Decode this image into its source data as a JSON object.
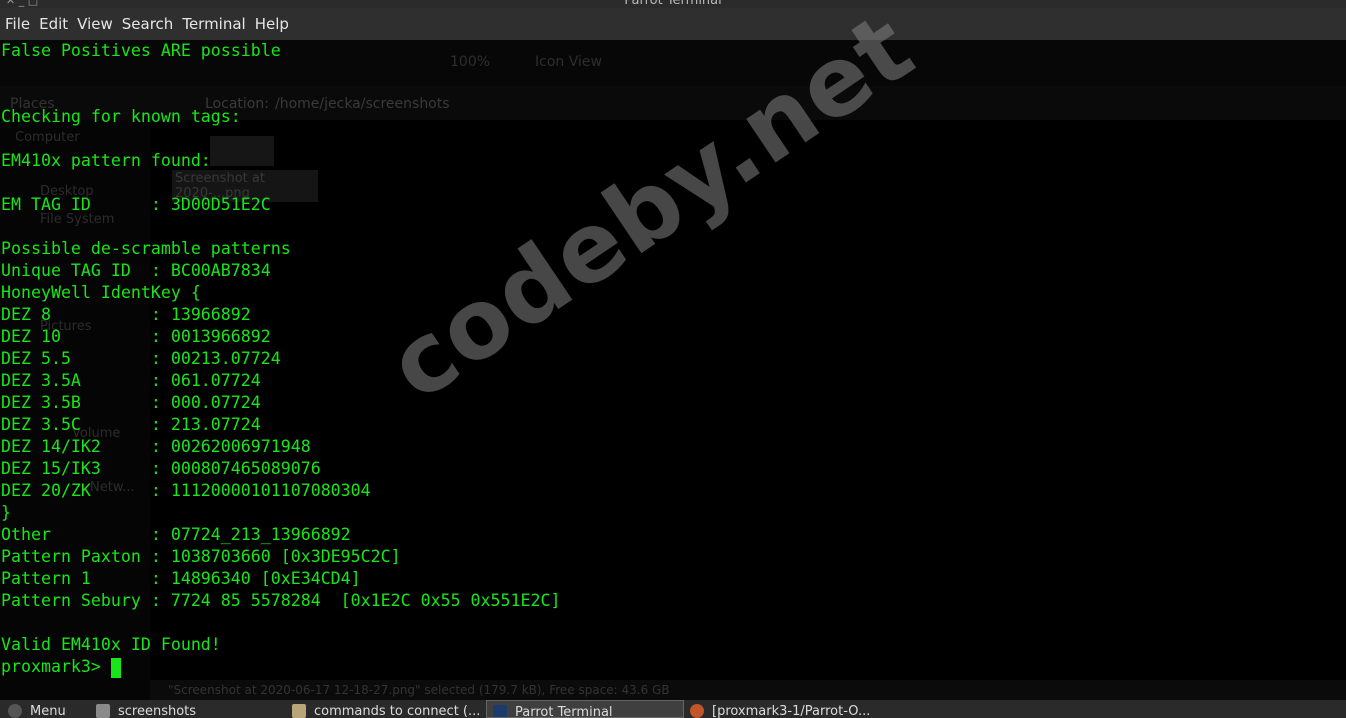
{
  "window": {
    "title": "Parrot Terminal"
  },
  "menu": {
    "items": [
      "File",
      "Edit",
      "View",
      "Search",
      "Terminal",
      "Help"
    ]
  },
  "background_window": {
    "zoom": "100%",
    "view_mode": "Icon View",
    "location_label": "Location:",
    "location_path": "/home/jecka/screenshots",
    "places_label": "Places",
    "sidebar_items": [
      "Computer",
      "Desktop",
      "File System",
      "Pictures",
      "Volume",
      "Netw..."
    ],
    "thumbnail_label": "Screenshot at 2020-...png",
    "status": "\"Screenshot at 2020-06-17 12-18-27.png\" selected (179.7 kB), Free space: 43.6 GB"
  },
  "terminal": {
    "lines": [
      "False Positives ARE possible",
      "",
      "",
      "Checking for known tags:",
      "",
      "EM410x pattern found:",
      "",
      "EM TAG ID      : 3D00D51E2C",
      "",
      "Possible de-scramble patterns",
      "Unique TAG ID  : BC00AB7834",
      "HoneyWell IdentKey {",
      "DEZ 8          : 13966892",
      "DEZ 10         : 0013966892",
      "DEZ 5.5        : 00213.07724",
      "DEZ 3.5A       : 061.07724",
      "DEZ 3.5B       : 000.07724",
      "DEZ 3.5C       : 213.07724",
      "DEZ 14/IK2     : 00262006971948",
      "DEZ 15/IK3     : 000807465089076",
      "DEZ 20/ZK      : 11120000101107080304",
      "}",
      "Other          : 07724_213_13966892",
      "Pattern Paxton : 1038703660 [0x3DE95C2C]",
      "Pattern 1      : 14896340 [0xE34CD4]",
      "Pattern Sebury : 7724 85 5578284  [0x1E2C 0x55 0x551E2C]",
      "",
      "Valid EM410x ID Found!",
      "proxmark3> "
    ],
    "text_color": "#18e618",
    "background_color": "#000000"
  },
  "watermark": {
    "text": "codeby.net"
  },
  "taskbar": {
    "items": [
      {
        "label": "Menu",
        "icon": "parrot-menu-icon"
      },
      {
        "label": "screenshots",
        "icon": "folder-icon"
      },
      {
        "label": "commands to connect (...",
        "icon": "text-editor-icon"
      },
      {
        "label": "Parrot Terminal",
        "icon": "terminal-icon",
        "active": true
      },
      {
        "label": "[proxmark3-1/Parrot-O...",
        "icon": "browser-icon"
      }
    ]
  }
}
